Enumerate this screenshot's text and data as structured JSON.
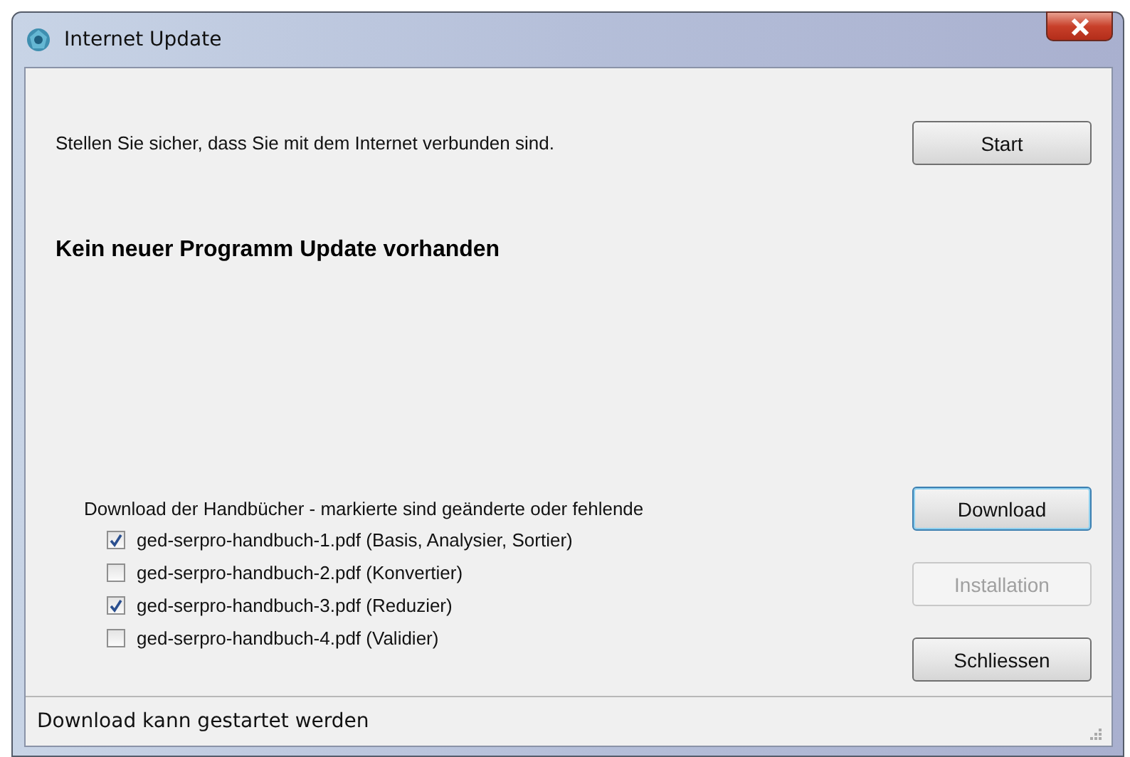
{
  "window": {
    "title": "Internet Update"
  },
  "instruction": "Stellen Sie sicher, dass Sie mit dem Internet verbunden sind.",
  "start_button": {
    "label": "Start",
    "disabled": false,
    "focused": false
  },
  "update_status": "Kein neuer Programm Update vorhanden",
  "manuals": {
    "label": "Download der Handbücher - markierte sind geänderte oder fehlende",
    "items": [
      {
        "label": "ged-serpro-handbuch-1.pdf (Basis, Analysier, Sortier)",
        "checked": true
      },
      {
        "label": "ged-serpro-handbuch-2.pdf (Konvertier)",
        "checked": false
      },
      {
        "label": "ged-serpro-handbuch-3.pdf (Reduzier)",
        "checked": true
      },
      {
        "label": "ged-serpro-handbuch-4.pdf (Validier)",
        "checked": false
      }
    ]
  },
  "buttons": [
    {
      "label": "Download",
      "disabled": false,
      "focused": true
    },
    {
      "label": "Installation",
      "disabled": true,
      "focused": false
    },
    {
      "label": "Schliessen",
      "disabled": false,
      "focused": false
    }
  ],
  "status_bar": "Download kann gestartet werden"
}
